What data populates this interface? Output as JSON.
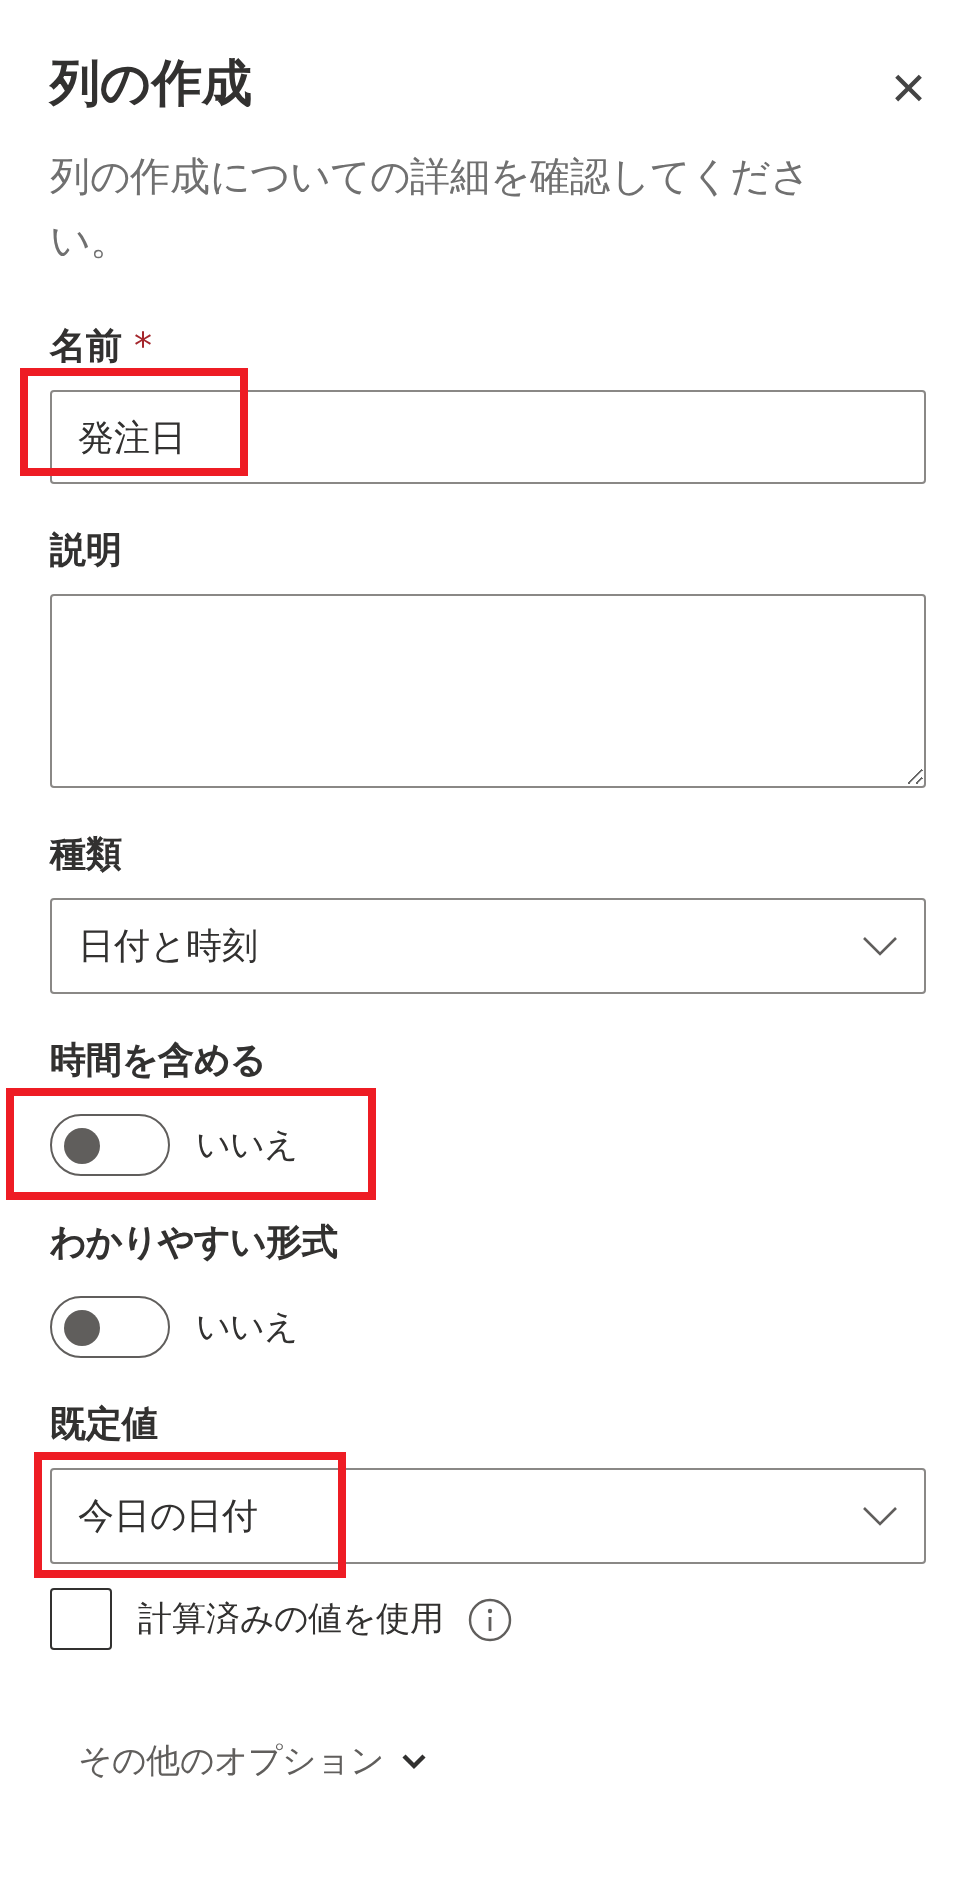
{
  "panel": {
    "title": "列の作成",
    "close_icon": "×",
    "description": "列の作成についての詳細を確認してください。"
  },
  "fields": [
    {
      "kind": "text",
      "label": "名前",
      "required_mark": "*",
      "value": "発注日",
      "highlighted": true
    },
    {
      "kind": "textarea",
      "label": "説明",
      "highlighted": false
    },
    {
      "kind": "select",
      "label": "種類",
      "value": "日付と時刻",
      "highlighted": false
    },
    {
      "kind": "toggle",
      "label": "時間を含める",
      "on": false,
      "value": "いいえ",
      "highlighted": true
    },
    {
      "kind": "toggle",
      "label": "わかりやすい形式",
      "on": false,
      "value": "いいえ",
      "highlighted": false
    },
    {
      "kind": "select",
      "label": "既定値",
      "value": "今日の日付",
      "highlighted": true
    }
  ],
  "calculated": {
    "label": "計算済みの値を使用",
    "checked": false
  },
  "more_options": {
    "label": "その他のオプション",
    "expanded": false
  }
}
